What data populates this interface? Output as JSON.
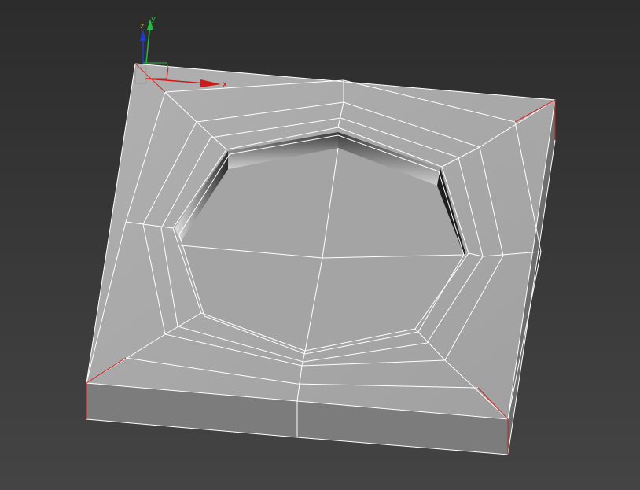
{
  "viewport": {
    "background_top": "#2c2c2c",
    "background_bottom": "#444444"
  },
  "model": {
    "top_face_color": "#a8a8a8",
    "inner_face_color": "#a6a6a6",
    "side_face_color": "#7a7a7a",
    "wire_color": "#ffffff",
    "selected_edge_color": "#cc1f1f"
  },
  "gizmo": {
    "x_label": "x",
    "y_label": "y",
    "z_label": "z",
    "x_color": "#d01818",
    "y_color": "#1fbf3a",
    "z_color": "#1a3cd6"
  }
}
